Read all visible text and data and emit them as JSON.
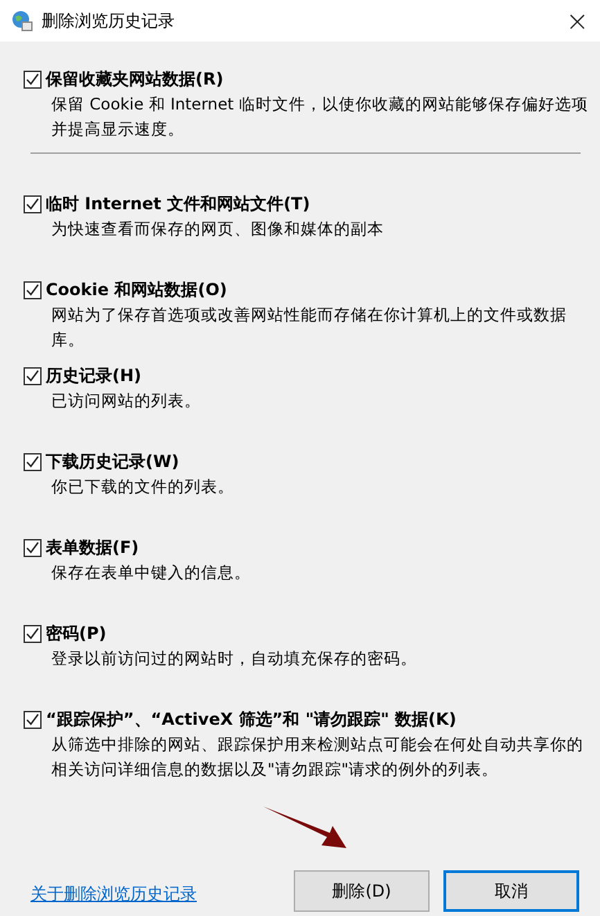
{
  "window": {
    "title": "删除浏览历史记录",
    "close": "×"
  },
  "option_groups": [
    [
      {
        "label": "保留收藏夹网站数据(R)",
        "checked": true,
        "description": "保留 Cookie 和 Internet 临时文件，以使你收藏的网站能够保存偏好选项并提高显示速度。"
      }
    ],
    [
      {
        "label": "临时 Internet 文件和网站文件(T)",
        "checked": true,
        "description": "为快速查看而保存的网页、图像和媒体的副本"
      },
      {
        "label": "Cookie 和网站数据(O)",
        "checked": true,
        "description": "网站为了保存首选项或改善网站性能而存储在你计算机上的文件或数据库。"
      },
      {
        "label": "历史记录(H)",
        "checked": true,
        "description": "已访问网站的列表。"
      },
      {
        "label": "下载历史记录(W)",
        "checked": true,
        "description": "你已下载的文件的列表。"
      },
      {
        "label": "表单数据(F)",
        "checked": true,
        "description": "保存在表单中键入的信息。"
      },
      {
        "label": "密码(P)",
        "checked": true,
        "description": "登录以前访问过的网站时，自动填充保存的密码。"
      },
      {
        "label": "“跟踪保护”、“ActiveX 筛选”和 \"请勿跟踪\" 数据(K)",
        "checked": true,
        "description": "从筛选中排除的网站、跟踪保护用来检测站点可能会在何处自动共享你的相关访问详细信息的数据以及\"请勿跟踪\"请求的例外的列表。"
      }
    ]
  ],
  "footer": {
    "link": "关于删除浏览历史记录",
    "buttons": [
      {
        "label": "删除(D)",
        "selected": false
      },
      {
        "label": "取消",
        "selected": true
      }
    ]
  }
}
